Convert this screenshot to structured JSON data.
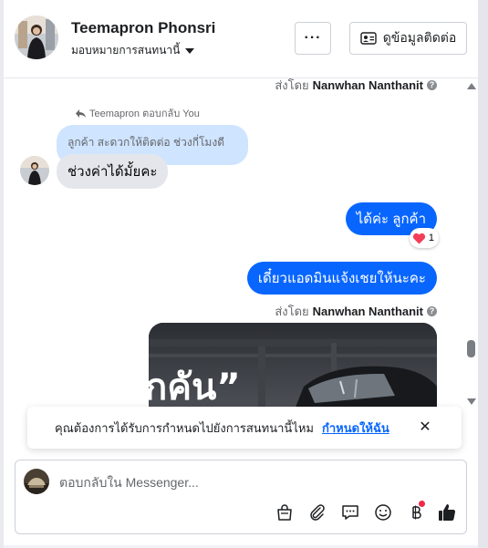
{
  "header": {
    "contact_name": "Teemapron Phonsri",
    "assign_label": "มอบหมายการสนทนานี้",
    "more_label": "···",
    "details_label": "ดูข้อมูลติดต่อ"
  },
  "conversation": {
    "top_sent_by_prefix": "ส่งโดย",
    "top_sent_by_name": "Nanwhan Nanthanit",
    "reply_note": "Teemapron ตอบกลับ You",
    "quoted_text": "ลูกค้า สะดวกให้ติดต่อ ช่วงกี่โมงดีคะ",
    "incoming_text": "ช่วงค่าได้มั้ยคะ",
    "outgoing_1": "ได้ค่ะ  ลูกค้า",
    "reaction_emoji": "❤️",
    "reaction_count": "1",
    "outgoing_2": "เดี๋ยวแอดมินแจ้งเชยให้นะคะ",
    "bottom_sent_by_prefix": "ส่งโดย",
    "bottom_sent_by_name": "Nanwhan Nanthanit",
    "image_caption_text": "กคัน”"
  },
  "notice": {
    "text": "คุณต้องการได้รับการกำหนดไปยังการสนทนานี้ไหม",
    "link": "กำหนดให้ฉัน",
    "close": "✕"
  },
  "composer": {
    "placeholder": "ตอบกลับใน Messenger...",
    "tools": [
      "shopping-bag-icon",
      "paperclip-icon",
      "saved-reply-icon",
      "emoji-icon",
      "baht-payment-icon",
      "thumbs-up-icon"
    ]
  },
  "colors": {
    "accent": "#0866ff",
    "quoted_bg": "#cfe4ff",
    "incoming_bg": "#e4e6eb",
    "notification_dot": "#f02849"
  }
}
